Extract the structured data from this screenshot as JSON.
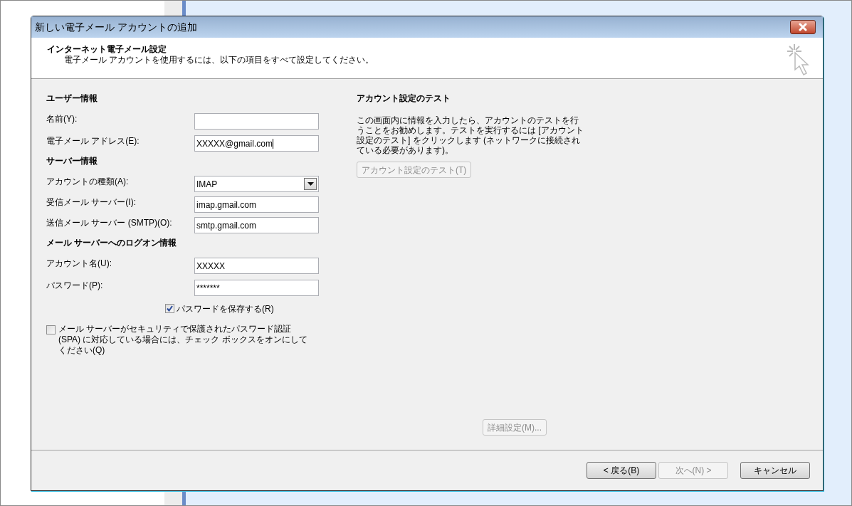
{
  "window": {
    "title": "新しい電子メール アカウントの追加"
  },
  "header": {
    "title": "インターネット電子メール設定",
    "subtitle": "電子メール アカウントを使用するには、以下の項目をすべて設定してください。"
  },
  "sections": [
    {
      "heading": "ユーザー情報",
      "fields": [
        {
          "label": "名前(Y):",
          "kind": "text"
        },
        {
          "label": "電子メール アドレス(E):",
          "kind": "text",
          "value": "XXXXX@gmail.com",
          "focused": true
        }
      ]
    },
    {
      "heading": "サーバー情報",
      "fields": [
        {
          "label": "アカウントの種類(A):",
          "kind": "select",
          "value": "IMAP"
        },
        {
          "label": "受信メール サーバー(I):",
          "kind": "text",
          "value": "imap.gmail.com"
        },
        {
          "label": "送信メール サーバー (SMTP)(O):",
          "kind": "text",
          "value": "smtp.gmail.com"
        }
      ]
    },
    {
      "heading": "メール サーバーへのログオン情報",
      "fields": [
        {
          "label": "アカウント名(U):",
          "kind": "text",
          "value": "XXXXX"
        },
        {
          "label": "パスワード(P):",
          "kind": "text",
          "value": "*******"
        }
      ]
    }
  ],
  "save_password": {
    "label": "パスワードを保存する(R)",
    "checked": true
  },
  "spa": {
    "label": "メール サーバーがセキュリティで保護されたパスワード認証 (SPA) に対応している場合には、チェック ボックスをオンにしてください(Q)",
    "checked": false
  },
  "test": {
    "heading": "アカウント設定のテスト",
    "description": "この画面内に情報を入力したら、アカウントのテストを行うことをお勧めします。テストを実行するには [アカウント設定のテスト] をクリックします (ネットワークに接続されている必要があります)。",
    "button": {
      "label": "アカウント設定のテスト(T)",
      "disabled": true
    }
  },
  "more_settings": {
    "label": "詳細設定(M)...",
    "disabled": true
  },
  "footer_buttons": [
    {
      "label": "< 戻る(B)",
      "disabled": false
    },
    {
      "label": "次へ(N) >",
      "disabled": true
    },
    {
      "label": "キャンセル",
      "disabled": false
    }
  ]
}
